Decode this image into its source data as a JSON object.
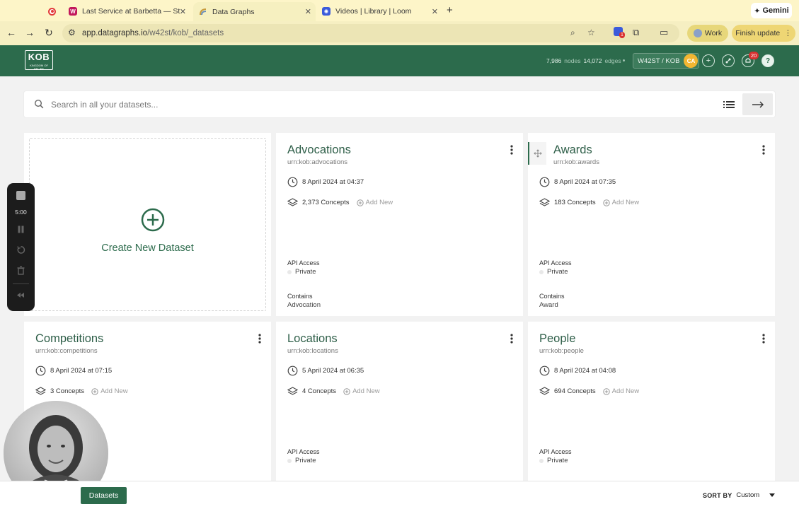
{
  "browser": {
    "tabs": [
      {
        "title": "",
        "icon": "record-icon"
      },
      {
        "title": "Last Service at Barbetta — St",
        "icon": "w-favicon"
      },
      {
        "title": "Data Graphs",
        "icon": "datagraphs-favicon"
      },
      {
        "title": "Videos | Library | Loom",
        "icon": "loom-favicon"
      }
    ],
    "gemini_label": "Gemini",
    "url_host": "app.datagraphs.io",
    "url_path": "/w42st/kob/_datasets",
    "extension_badge": "1",
    "work_label": "Work",
    "finish_update_label": "Finish update"
  },
  "header": {
    "logo_text": "KOB",
    "logo_subtext": "KINGDOM OF BELIEF",
    "nodes_count": "7,986",
    "nodes_label": "nodes",
    "edges_count": "14,072",
    "edges_label": "edges",
    "workspace": "W42ST / KOB",
    "avatar_initials": "CA",
    "notifications_count": "20"
  },
  "search": {
    "placeholder": "Search in all your datasets..."
  },
  "create_card": {
    "label": "Create New Dataset"
  },
  "datasets": [
    {
      "name": "Advocations",
      "urn": "urn:kob:advocations",
      "date": "8 April 2024 at 04:37",
      "concepts": "2,373 Concepts",
      "add_new": "Add New",
      "api_label": "API Access",
      "api_value": "Private",
      "contains_label": "Contains",
      "contains_value": "Advocation"
    },
    {
      "name": "Awards",
      "urn": "urn:kob:awards",
      "date": "8 April 2024 at 07:35",
      "concepts": "183 Concepts",
      "add_new": "Add New",
      "api_label": "API Access",
      "api_value": "Private",
      "contains_label": "Contains",
      "contains_value": "Award"
    },
    {
      "name": "Competitions",
      "urn": "urn:kob:competitions",
      "date": "8 April 2024 at 07:15",
      "concepts": "3 Concepts",
      "add_new": "Add New"
    },
    {
      "name": "Locations",
      "urn": "urn:kob:locations",
      "date": "5 April 2024 at 06:35",
      "concepts": "4 Concepts",
      "add_new": "Add New",
      "api_label": "API Access",
      "api_value": "Private"
    },
    {
      "name": "People",
      "urn": "urn:kob:people",
      "date": "8 April 2024 at 04:08",
      "concepts": "694 Concepts",
      "add_new": "Add New",
      "api_label": "API Access",
      "api_value": "Private"
    }
  ],
  "recorder": {
    "timer": "5:00"
  },
  "footer": {
    "datasets_label": "Datasets",
    "sort_label": "SORT BY",
    "sort_value": "Custom"
  },
  "colors": {
    "brand_green": "#2c6b4c",
    "chrome_yellow": "#fdf5c8",
    "avatar_orange": "#f2b632",
    "badge_red": "#d93030"
  }
}
